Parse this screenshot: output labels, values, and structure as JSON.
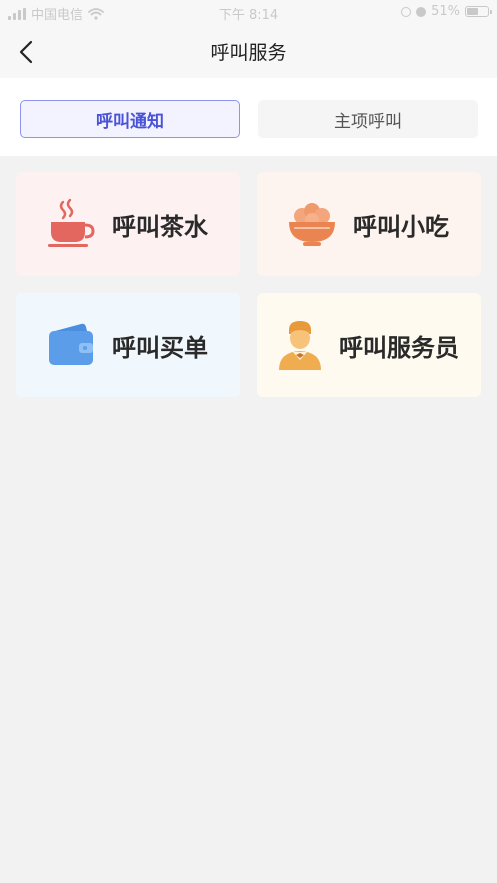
{
  "status_bar": {
    "carrier": "中国电信",
    "time": "下午 8:14",
    "battery": "51%"
  },
  "nav": {
    "title": "呼叫服务"
  },
  "tabs": [
    {
      "label": "呼叫通知",
      "active": true
    },
    {
      "label": "主项呼叫",
      "active": false
    }
  ],
  "cards": [
    {
      "label": "呼叫茶水",
      "icon": "tea-cup-icon",
      "bg": "#fdf2f1",
      "color": "#e3675f"
    },
    {
      "label": "呼叫小吃",
      "icon": "snack-bowl-icon",
      "bg": "#fdf4f0",
      "color": "#ea8552"
    },
    {
      "label": "呼叫买单",
      "icon": "wallet-icon",
      "bg": "#f1f8fd",
      "color": "#5b9de8"
    },
    {
      "label": "呼叫服务员",
      "icon": "waiter-icon",
      "bg": "#fefaf0",
      "color": "#efad4f"
    }
  ]
}
